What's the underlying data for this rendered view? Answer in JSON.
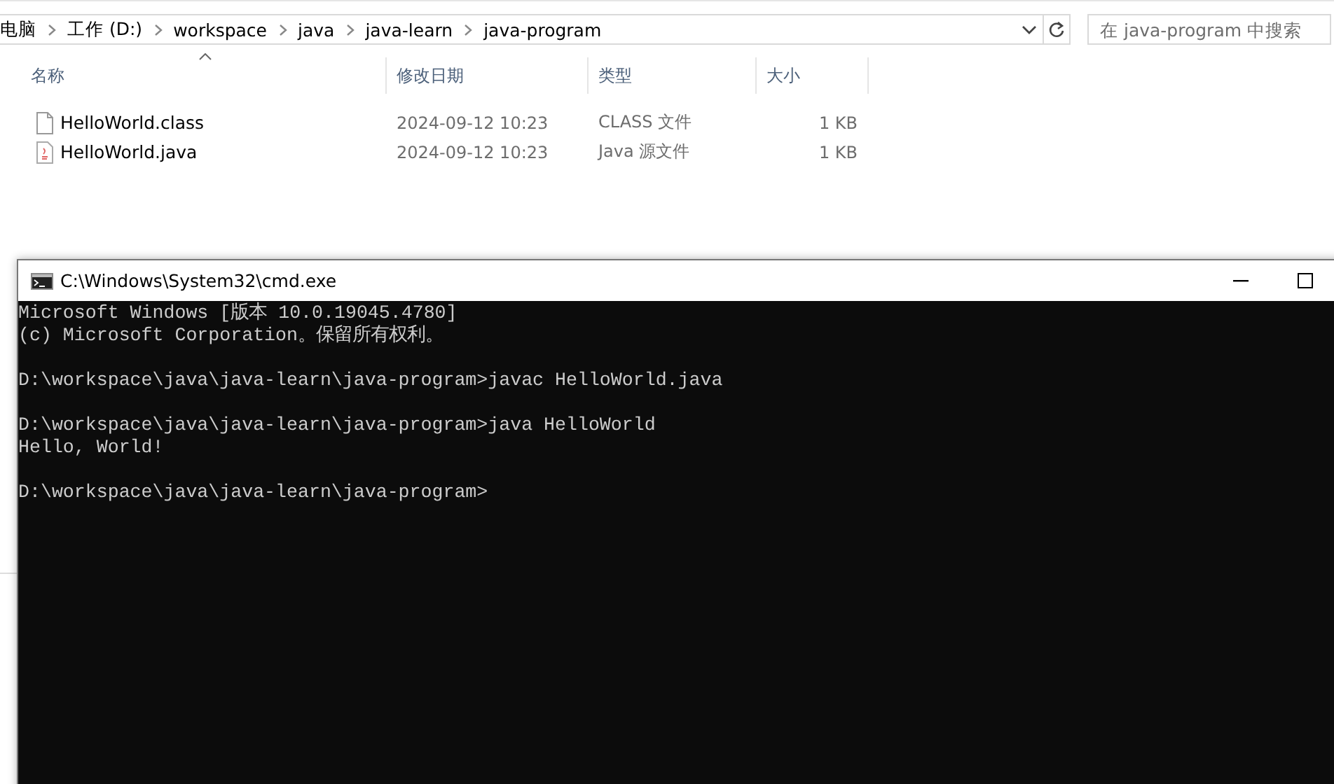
{
  "explorer": {
    "breadcrumb": [
      "电脑",
      "工作 (D:)",
      "workspace",
      "java",
      "java-learn",
      "java-program"
    ],
    "search": {
      "placeholder": "在 java-program 中搜索"
    },
    "columns": [
      {
        "label": "名称",
        "sorted": true
      },
      {
        "label": "修改日期",
        "sorted": false
      },
      {
        "label": "类型",
        "sorted": false
      },
      {
        "label": "大小",
        "sorted": false
      }
    ],
    "files": [
      {
        "kind": "class",
        "name": "HelloWorld.class",
        "modified": "2024-09-12 10:23",
        "type": "CLASS 文件",
        "size": "1 KB"
      },
      {
        "kind": "java",
        "name": "HelloWorld.java",
        "modified": "2024-09-12 10:23",
        "type": "Java 源文件",
        "size": "1 KB"
      }
    ]
  },
  "console": {
    "title": "C:\\Windows\\System32\\cmd.exe",
    "blocks": [
      [
        "Microsoft Windows [版本 10.0.19045.4780]",
        "(c) Microsoft Corporation。保留所有权利。"
      ],
      [
        "D:\\workspace\\java\\java-learn\\java-program>javac HelloWorld.java"
      ],
      [
        "D:\\workspace\\java\\java-learn\\java-program>java HelloWorld",
        "Hello, World!"
      ],
      [
        "D:\\workspace\\java\\java-learn\\java-program>"
      ]
    ]
  }
}
